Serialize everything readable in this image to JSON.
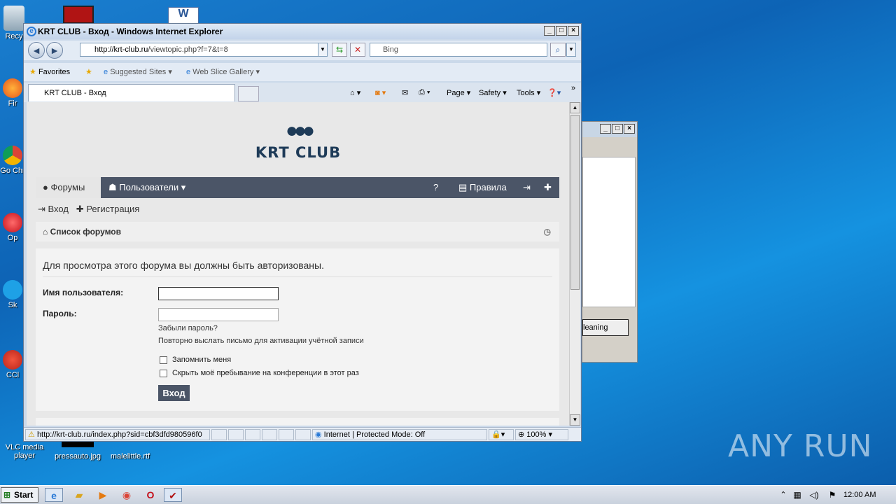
{
  "desktop": {
    "icons": [
      {
        "label": "Recy",
        "name": "recycle-bin"
      },
      {
        "label": "Fir",
        "name": "firefox"
      },
      {
        "label": "Go Chr",
        "name": "chrome"
      },
      {
        "label": "Op",
        "name": "opera"
      },
      {
        "label": "Sk",
        "name": "skype"
      },
      {
        "label": "CCl",
        "name": "ccleaner"
      },
      {
        "label": "VLC media player",
        "name": "vlc"
      },
      {
        "label": "pressauto.jpg",
        "name": "pressauto"
      },
      {
        "label": "malelittle.rtf",
        "name": "malelittle"
      }
    ],
    "watermark": "ANY RUN"
  },
  "bg_window": {
    "button_label": "leaning"
  },
  "ie": {
    "title": "KRT CLUB - Вход - Windows Internet Explorer",
    "url_domain": "http://krt-club.ru",
    "url_path": "/viewtopic.php?f=7&t=8",
    "search_placeholder": "Bing",
    "favorites": {
      "favorites_label": "Favorites",
      "suggested_label": "Suggested Sites",
      "webslice_label": "Web Slice Gallery"
    },
    "tab_title": "KRT CLUB - Вход",
    "commands": {
      "page": "Page",
      "safety": "Safety",
      "tools": "Tools"
    },
    "status": {
      "url": "http://krt-club.ru/index.php?sid=cbf3dfd980596f0",
      "zone": "Internet | Protected Mode: Off",
      "zoom": "100%"
    }
  },
  "page": {
    "logo_text": "KRT CLUB",
    "nav": {
      "forums": "Форумы",
      "users": "Пользователи",
      "rules": "Правила"
    },
    "sublinks": {
      "login": "Вход",
      "register": "Регистрация"
    },
    "breadcrumb": "Список форумов",
    "login": {
      "message": "Для просмотра этого форума вы должны быть авторизованы.",
      "username_label": "Имя пользователя:",
      "password_label": "Пароль:",
      "forgot_link": "Забыли пароль?",
      "resend_link": "Повторно выслать письмо для активации учётной записи",
      "remember_label": "Запомнить меня",
      "hide_label": "Скрыть моё пребывание на конференции в этот раз",
      "submit": "Вход"
    }
  },
  "taskbar": {
    "start": "Start",
    "time": "12:00 AM"
  }
}
